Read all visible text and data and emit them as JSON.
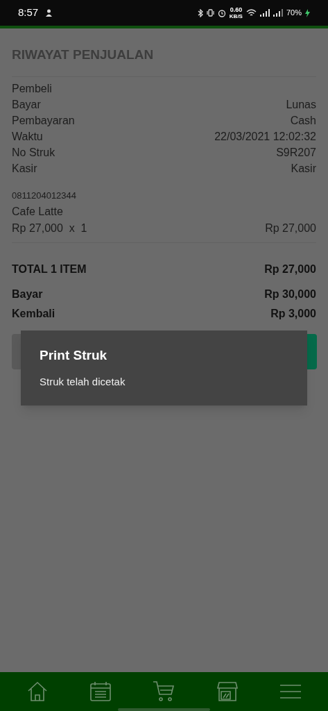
{
  "status_bar": {
    "time": "8:57",
    "speed_value": "0.60",
    "speed_unit": "KB/S",
    "battery": "70%"
  },
  "header": {
    "title": "RIWAYAT PENJUALAN"
  },
  "details": [
    {
      "label": "Pembeli"
    },
    {
      "label": "Bayar",
      "value": "Lunas"
    },
    {
      "label": "Pembayaran",
      "value": "Cash"
    },
    {
      "label": "Waktu",
      "value": "22/03/2021 12:02:32"
    },
    {
      "label": "No Struk",
      "value": "S9R207"
    },
    {
      "label": "Kasir",
      "value": "Kasir"
    }
  ],
  "items": [
    {
      "code": "0811204012344",
      "name": "Cafe Latte",
      "price_qty": "Rp 27,000  x  1",
      "subtotal": "Rp 27,000"
    }
  ],
  "total": {
    "label": "TOTAL 1 ITEM",
    "value": "Rp 27,000"
  },
  "payment": [
    {
      "label": "Bayar",
      "value": "Rp 30,000"
    },
    {
      "label": "Kembali",
      "value": "Rp 3,000"
    }
  ],
  "dialog": {
    "title": "Print Struk",
    "message": "Struk telah dicetak"
  },
  "nav": [
    {
      "kind": "home"
    },
    {
      "kind": "calendar"
    },
    {
      "kind": "cart"
    },
    {
      "kind": "store"
    },
    {
      "kind": "menu"
    }
  ]
}
